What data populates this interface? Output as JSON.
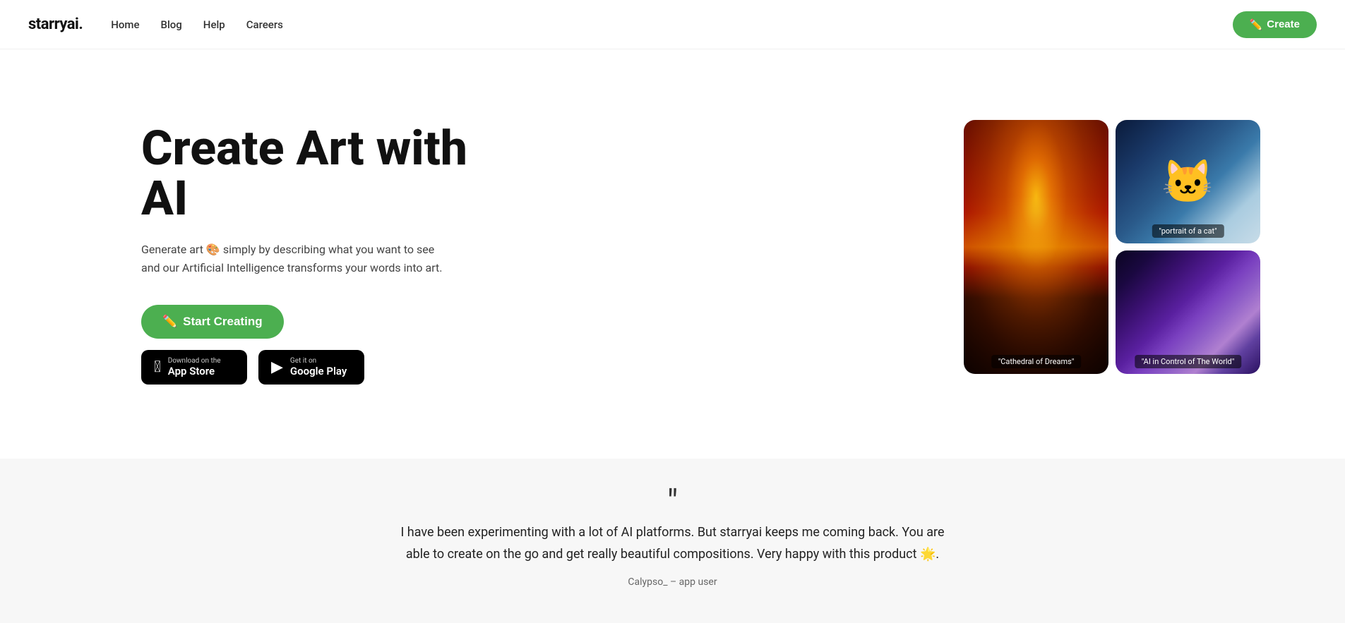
{
  "nav": {
    "logo": "starryai.",
    "links": [
      {
        "label": "Home",
        "href": "#"
      },
      {
        "label": "Blog",
        "href": "#"
      },
      {
        "label": "Help",
        "href": "#"
      },
      {
        "label": "Careers",
        "href": "#"
      }
    ],
    "create_button": "Create"
  },
  "hero": {
    "title": "Create Art with AI",
    "subtitle_line1": "Generate art 🎨 simply by describing what you want to see",
    "subtitle_line2": "and our Artificial Intelligence transforms your words into art.",
    "start_creating": "Start Creating",
    "pencil_emoji": "✏️",
    "app_store": {
      "small": "Download on the",
      "big": "App Store",
      "icon": ""
    },
    "google_play": {
      "small": "Get it on",
      "big": "Google Play",
      "icon": "▶"
    }
  },
  "art_images": [
    {
      "label": "\"Cathedral of Dreams\"",
      "type": "cathedral"
    },
    {
      "label": "\"portrait of a cat\"",
      "type": "cat"
    },
    {
      "label": "\"AI in Control of The World\"",
      "type": "space"
    }
  ],
  "testimonial": {
    "quote": "I have been experimenting with a lot of AI platforms. But starryai keeps me coming back. You are able to create on the go and get really beautiful compositions. Very happy with this product 🌟.",
    "author": "Calypso_ – app user"
  }
}
